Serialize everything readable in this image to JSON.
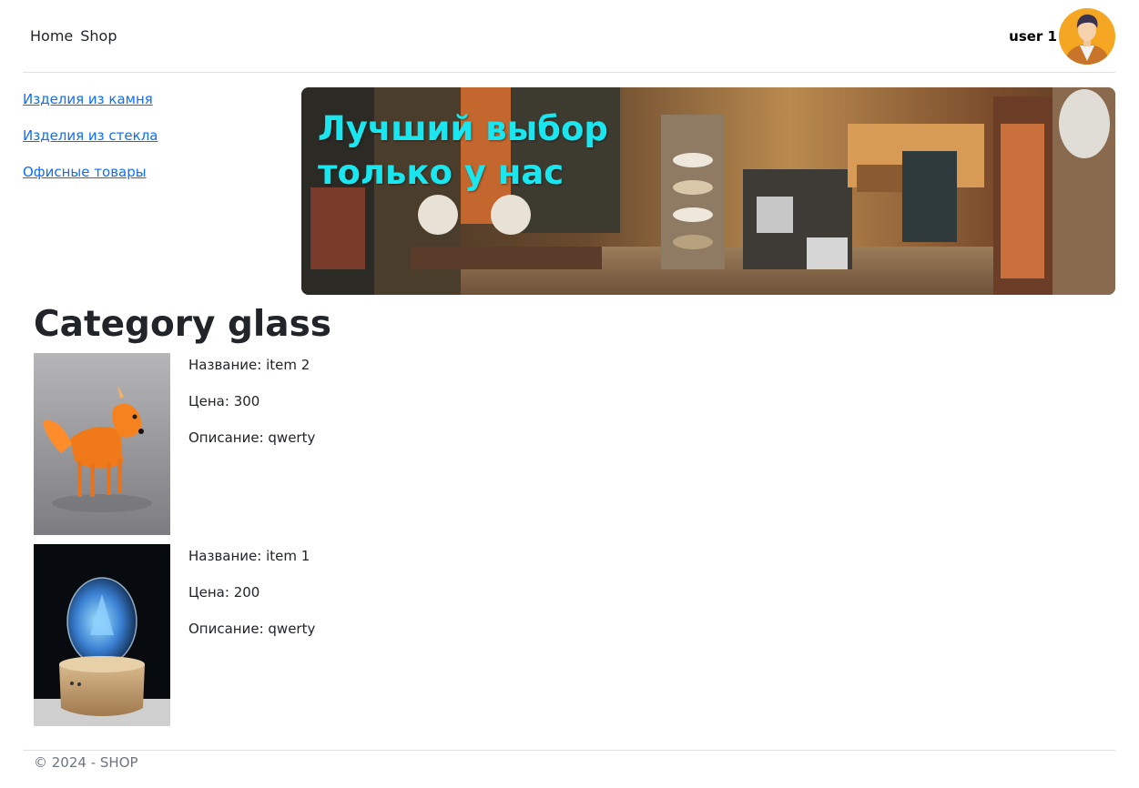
{
  "nav": {
    "links": [
      "Home",
      "Shop"
    ],
    "user": "user 1"
  },
  "sidebar": {
    "categories": [
      "Изделия из камня",
      "Изделия из стекла",
      "Офисные товары"
    ]
  },
  "banner": {
    "text": "Лучший выбор\nтолько у нас"
  },
  "category": {
    "title": "Category glass"
  },
  "products": [
    {
      "name": "Название: item 2",
      "price": "Цена: 300",
      "description": "Описание: qwerty"
    },
    {
      "name": "Название: item 1",
      "price": "Цена: 200",
      "description": "Описание: qwerty"
    }
  ],
  "footer": {
    "text": "© 2024 - SHOP"
  },
  "colors": {
    "link": "#0d6efd",
    "banner_text": "#19e6ee",
    "border": "#dee2e6"
  }
}
